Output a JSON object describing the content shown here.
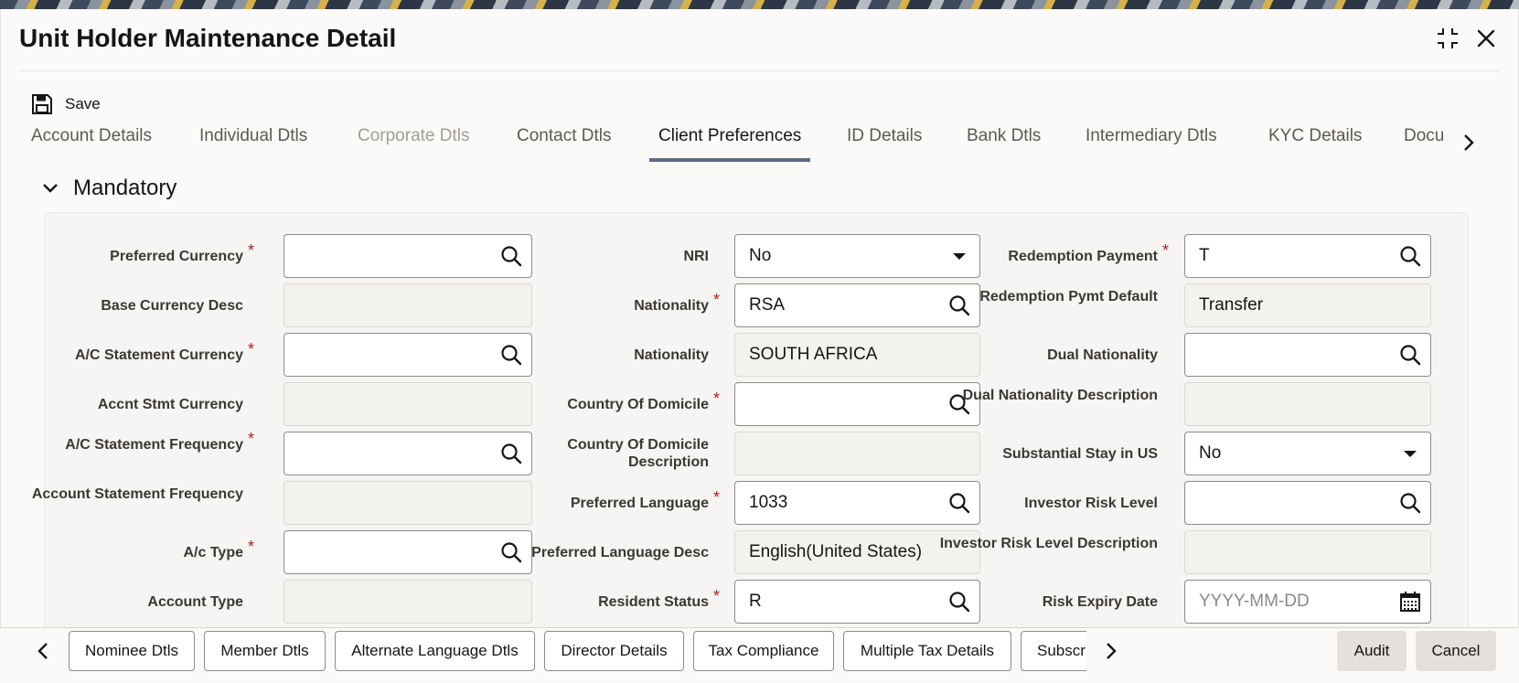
{
  "window": {
    "title": "Unit Holder Maintenance Detail"
  },
  "toolbar": {
    "save_label": "Save"
  },
  "tabs": [
    {
      "label": "Account Details",
      "state": "normal"
    },
    {
      "label": "Individual Dtls",
      "state": "normal"
    },
    {
      "label": "Corporate Dtls",
      "state": "disabled"
    },
    {
      "label": "Contact Dtls",
      "state": "normal"
    },
    {
      "label": "Client Preferences",
      "state": "active"
    },
    {
      "label": "ID Details",
      "state": "normal"
    },
    {
      "label": "Bank Dtls",
      "state": "normal"
    },
    {
      "label": "Intermediary Dtls",
      "state": "normal"
    },
    {
      "label": "KYC Details",
      "state": "normal"
    },
    {
      "label": "Docu",
      "state": "normal"
    }
  ],
  "section": {
    "title": "Mandatory"
  },
  "fields": {
    "col1": [
      {
        "label": "Preferred Currency",
        "required": true,
        "value": "",
        "type": "lov"
      },
      {
        "label": "Base Currency Desc",
        "required": false,
        "value": "",
        "type": "readonly"
      },
      {
        "label": "A/C Statement Currency",
        "required": true,
        "value": "",
        "type": "lov"
      },
      {
        "label": "Accnt Stmt Currency",
        "required": false,
        "value": "",
        "type": "readonly"
      },
      {
        "label": "A/C Statement Frequency",
        "required": true,
        "value": "",
        "type": "lov"
      },
      {
        "label": "Account Statement Frequency",
        "required": false,
        "value": "",
        "type": "readonly"
      },
      {
        "label": "A/c Type",
        "required": true,
        "value": "",
        "type": "lov"
      },
      {
        "label": "Account Type",
        "required": false,
        "value": "",
        "type": "readonly"
      }
    ],
    "col2": [
      {
        "label": "NRI",
        "required": false,
        "value": "No",
        "type": "select"
      },
      {
        "label": "Nationality",
        "required": true,
        "value": "RSA",
        "type": "lov"
      },
      {
        "label": "Nationality",
        "required": false,
        "value": "SOUTH AFRICA",
        "type": "readonly"
      },
      {
        "label": "Country Of Domicile",
        "required": true,
        "value": "",
        "type": "lov"
      },
      {
        "label": "Country Of Domicile Description",
        "required": false,
        "value": "",
        "type": "readonly"
      },
      {
        "label": "Preferred Language",
        "required": true,
        "value": "1033",
        "type": "lov"
      },
      {
        "label": "Preferred Language Desc",
        "required": false,
        "value": "English(United States)",
        "type": "readonly"
      },
      {
        "label": "Resident Status",
        "required": true,
        "value": "R",
        "type": "lov"
      }
    ],
    "col3": [
      {
        "label": "Redemption Payment",
        "required": true,
        "value": "T",
        "type": "lov"
      },
      {
        "label": "Redemption Pymt Default",
        "required": false,
        "value": "Transfer",
        "type": "readonly"
      },
      {
        "label": "Dual Nationality",
        "required": false,
        "value": "",
        "type": "lov"
      },
      {
        "label": "Dual Nationality Description",
        "required": false,
        "value": "",
        "type": "readonly"
      },
      {
        "label": "Substantial Stay in US",
        "required": false,
        "value": "No",
        "type": "select"
      },
      {
        "label": "Investor Risk Level",
        "required": false,
        "value": "",
        "type": "lov"
      },
      {
        "label": "Investor Risk Level Description",
        "required": false,
        "value": "",
        "type": "readonly"
      },
      {
        "label": "Risk Expiry Date",
        "required": false,
        "value": "",
        "placeholder": "YYYY-MM-DD",
        "type": "date"
      }
    ]
  },
  "footer": {
    "buttons": [
      "Nominee Dtls",
      "Member Dtls",
      "Alternate Language Dtls",
      "Director Details",
      "Tax Compliance",
      "Multiple Tax Details",
      "Subscr"
    ],
    "audit_label": "Audit",
    "cancel_label": "Cancel"
  },
  "icons": {
    "search": "search-icon",
    "dropdown": "caret-down-icon",
    "calendar": "calendar-icon",
    "save": "floppy-disk-icon",
    "maximize": "maximize-icon",
    "close": "close-icon"
  },
  "colors": {
    "active_tab_underline": "#5e6a83",
    "required_marker": "#b3211e"
  }
}
